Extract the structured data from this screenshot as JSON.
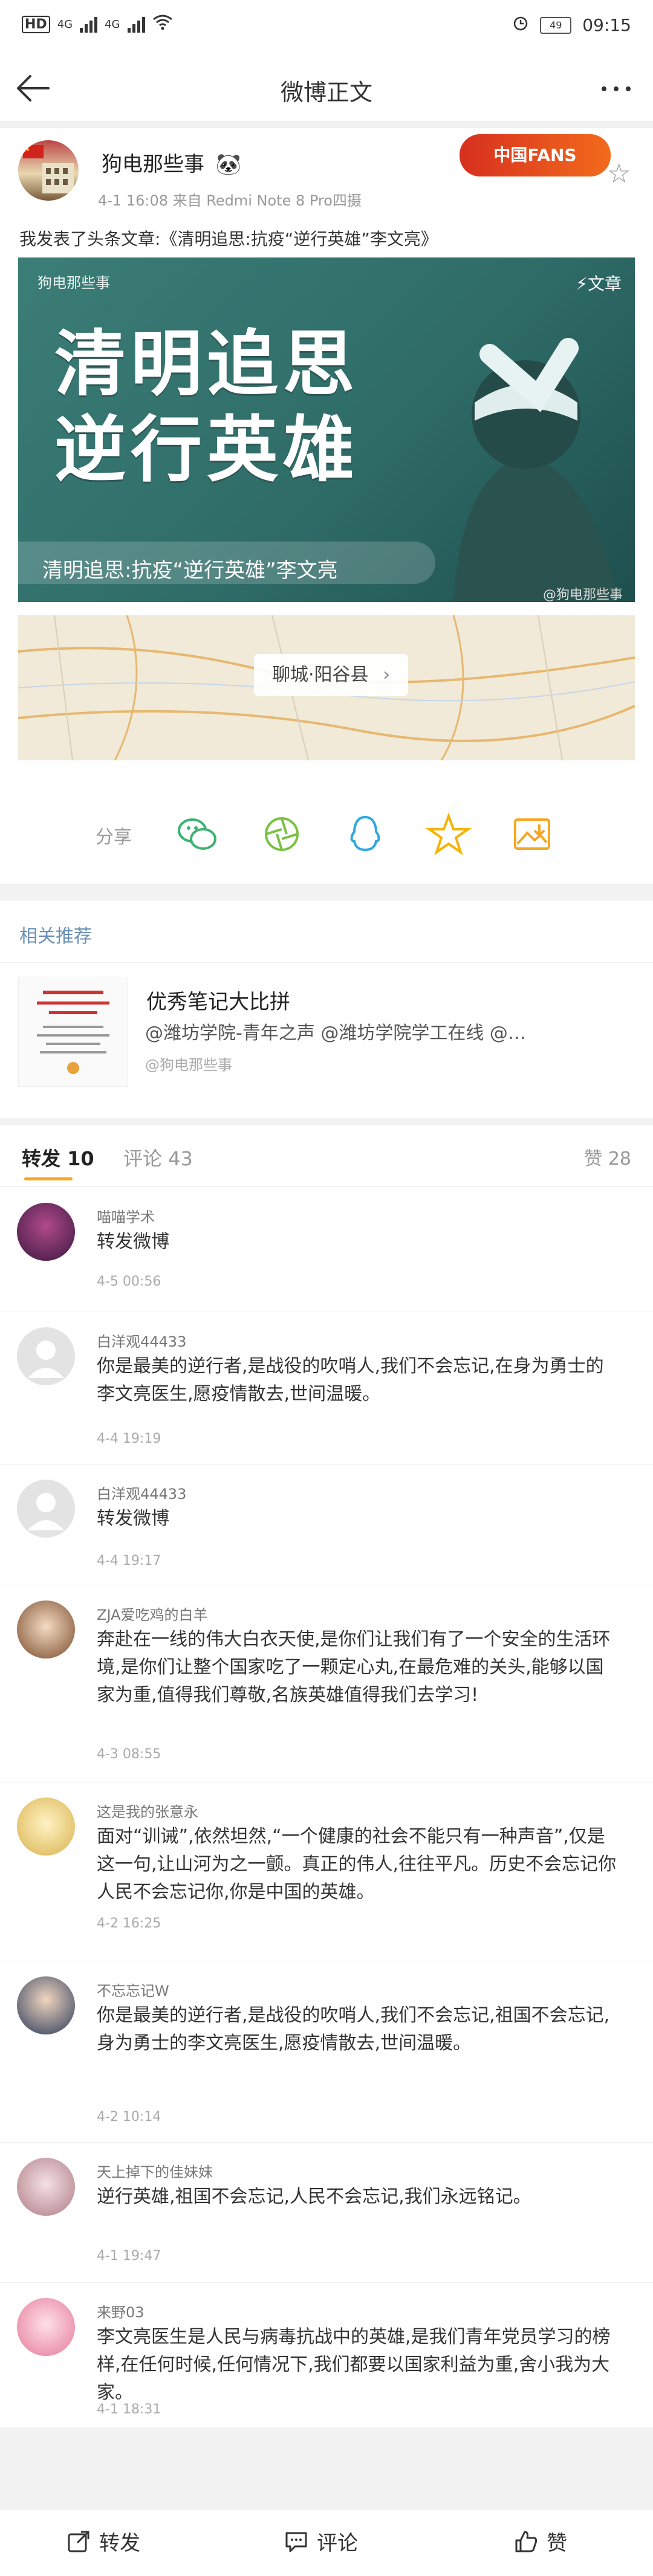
{
  "status_bar": {
    "left_label": "HD",
    "net1": "4G",
    "net2": "4G",
    "battery": "49",
    "time": "09:15"
  },
  "nav": {
    "title": "微博正文"
  },
  "post": {
    "author": "狗电那些事",
    "meta": "4-1 16:08  来自 Redmi Note 8 Pro四摄",
    "fans_badge": "中国FANS",
    "text": "我发表了头条文章:《清明追思:抗疫“逆行英雄”李文亮》",
    "article": {
      "author": "狗电那些事",
      "tag": "文章",
      "title_line1": "清明追思",
      "title_line2": "逆行英雄",
      "caption": "清明追思:抗疫“逆行英雄”李文亮",
      "watermark": "@狗电那些事"
    },
    "location": "聊城·阳谷县",
    "share_label": "分享"
  },
  "related": {
    "section_title": "相关推荐",
    "heading": "优秀笔记大比拼",
    "tags": "@潍坊学院-青年之声 @潍坊学院学工在线 @…",
    "source": "@狗电那些事"
  },
  "tabs": {
    "repost": "转发 10",
    "comment": "评论 43",
    "like": "赞 28"
  },
  "comments": [
    {
      "name": "喵喵学术",
      "text": "转发微博",
      "time": "4-5 00:56"
    },
    {
      "name": "白洋观44433",
      "text": "你是最美的逆行者,是战役的吹哨人,我们不会忘记,在身为勇士的李文亮医生,愿疫情散去,世间温暖。",
      "time": "4-4 19:19"
    },
    {
      "name": "白洋观44433",
      "text": "转发微博",
      "time": "4-4 19:17"
    },
    {
      "name": "ZJA爱吃鸡的白羊",
      "text": "奔赴在一线的伟大白衣天使,是你们让我们有了一个安全的生活环境,是你们让整个国家吃了一颗定心丸,在最危难的关头,能够以国家为重,值得我们尊敬,名族英雄值得我们去学习!",
      "time": "4-3 08:55"
    },
    {
      "name": "这是我的张意永",
      "text": "面对“训诫”,依然坦然,“一个健康的社会不能只有一种声音”,仅是这一句,让山河为之一颤。真正的伟人,往往平凡。历史不会忘记你人民不会忘记你,你是中国的英雄。",
      "time": "4-2 16:25"
    },
    {
      "name": "不忘忘记W",
      "text": "你是最美的逆行者,是战役的吹哨人,我们不会忘记,祖国不会忘记,身为勇士的李文亮医生,愿疫情散去,世间温暖。",
      "time": "4-2 10:14"
    },
    {
      "name": "天上掉下的佳妹妹",
      "text": "逆行英雄,祖国不会忘记,人民不会忘记,我们永远铭记。",
      "time": "4-1 19:47"
    },
    {
      "name": "来野03",
      "text": "李文亮医生是人民与病毒抗战中的英雄,是我们青年党员学习的榜样,在任何时候,任何情况下,我们都要以国家利益为重,舍小我为大家。",
      "time": "4-1 18:31"
    }
  ],
  "bottom_bar": {
    "repost": "转发",
    "comment": "评论",
    "like": "赞"
  }
}
